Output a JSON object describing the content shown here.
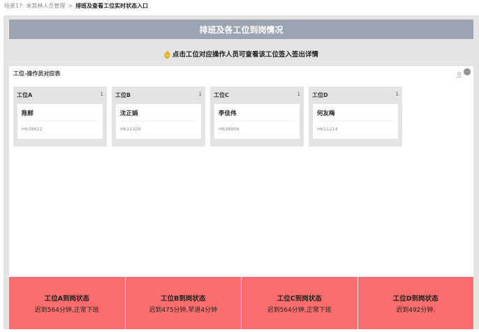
{
  "breadcrumb": {
    "scene": "场景17:",
    "parent": "米其林人员管理",
    "separator": ">",
    "current": "排班及查看工位实时状态入口"
  },
  "header": {
    "title": "排班及各工位到岗情况"
  },
  "tip": {
    "text": "点击工位对应操作人员可查看该工位签入签出详情",
    "icon": "pointing-hand-icon"
  },
  "panel": {
    "title": "工位-操作员对应表"
  },
  "stations": [
    {
      "name": "工位A",
      "count": "1",
      "operator": {
        "name": "陈鲜",
        "id": "H639622"
      }
    },
    {
      "name": "工位B",
      "count": "1",
      "operator": {
        "name": "沈正娟",
        "id": "H611329"
      }
    },
    {
      "name": "工位C",
      "count": "1",
      "operator": {
        "name": "李佳伟",
        "id": "H638906"
      }
    },
    {
      "name": "工位D",
      "count": "1",
      "operator": {
        "name": "何友梅",
        "id": "H611214"
      }
    }
  ],
  "status": [
    {
      "title": "工位A到岗状态",
      "desc": "迟到564分钟,正常下班"
    },
    {
      "title": "工位B到岗状态",
      "desc": "迟到475分钟,早退4分钟"
    },
    {
      "title": "工位C到岗状态",
      "desc": "迟到564分钟,正常下班"
    },
    {
      "title": "工位D到岗状态",
      "desc": "迟到492分钟,"
    }
  ],
  "colors": {
    "title_bar": "#9aa5b1",
    "status_card": "#fb6e6d",
    "background": "#e4e4e4"
  }
}
